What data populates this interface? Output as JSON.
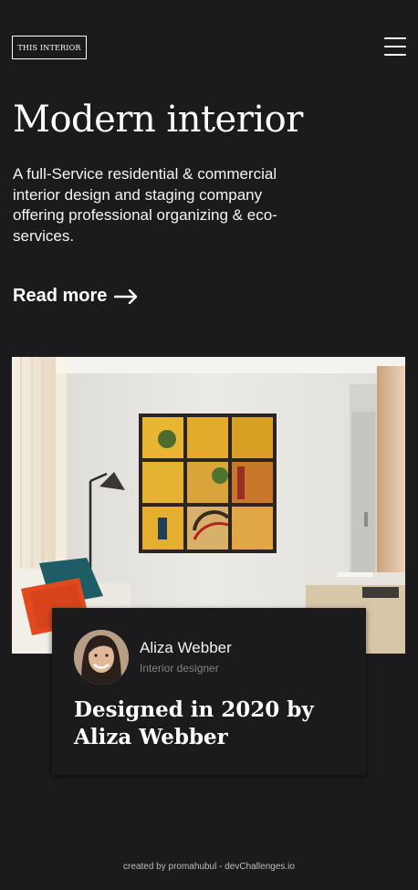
{
  "header": {
    "logo_text": "THIS INTERIOR",
    "menu_icon": "hamburger-menu-icon"
  },
  "hero": {
    "title": "Modern interior",
    "description": "A full-Service residential & commercial interior design and staging company offering professional organizing & eco-services.",
    "read_more_label": "Read more",
    "read_more_icon": "arrow-right-icon"
  },
  "feature": {
    "photo_subject": "living room with framed yellow wall art, floor lamp, orange and teal cushions",
    "author_name": "Aliza Webber",
    "author_role": "Interior designer",
    "title": "Designed in 2020 by Aliza Webber"
  },
  "footer": {
    "credit": "created by promahubul - devChallenges.io"
  },
  "colors": {
    "background": "#1b1b1d",
    "text": "#ffffff",
    "muted": "#828282"
  }
}
